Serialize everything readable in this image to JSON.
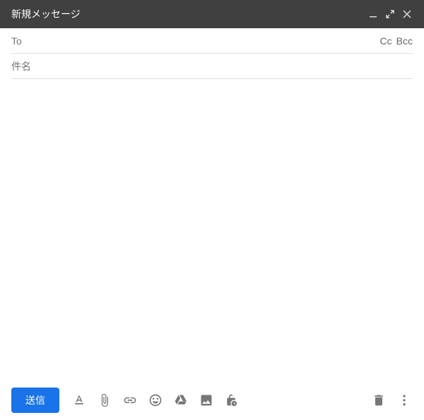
{
  "window": {
    "title": "新規メッセージ"
  },
  "fields": {
    "to_label": "To",
    "to_value": "",
    "cc_label": "Cc",
    "bcc_label": "Bcc",
    "subject_placeholder": "件名",
    "subject_value": "",
    "body_value": ""
  },
  "toolbar": {
    "send_label": "送信"
  },
  "colors": {
    "titlebar": "#404040",
    "accent": "#1a73e8"
  }
}
